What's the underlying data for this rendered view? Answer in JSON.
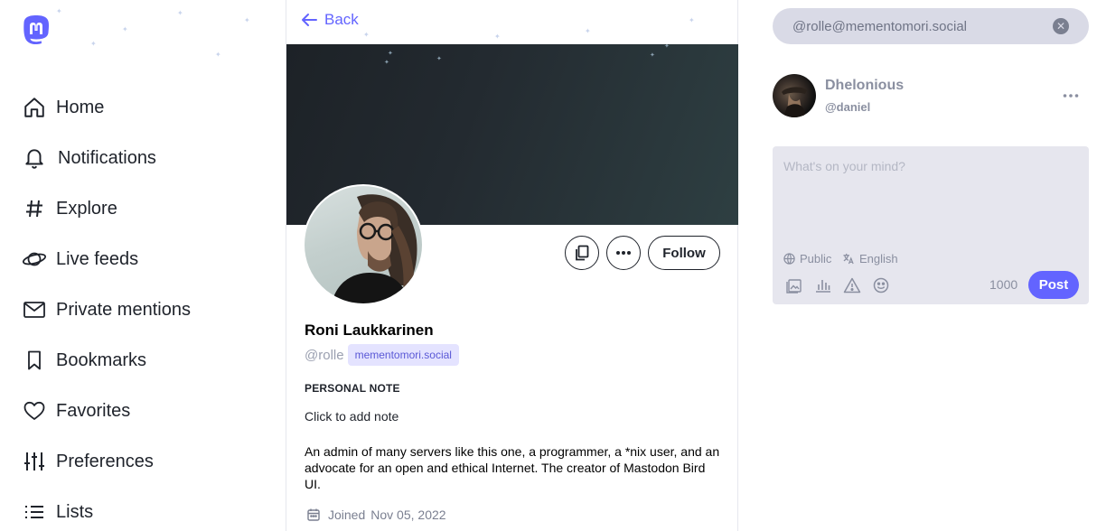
{
  "colors": {
    "accent": "#6364ff",
    "chip_bg": "#e4e3ff",
    "search_bg": "#d9dae6",
    "compose_bg": "#e6e6ee"
  },
  "sidebar": {
    "logo_icon": "mastodon-logo",
    "items": [
      {
        "label": "Home",
        "icon": "home-icon"
      },
      {
        "label": "Notifications",
        "icon": "bell-icon"
      },
      {
        "label": "Explore",
        "icon": "hash-icon"
      },
      {
        "label": "Live feeds",
        "icon": "planet-icon"
      },
      {
        "label": "Private mentions",
        "icon": "mail-icon"
      },
      {
        "label": "Bookmarks",
        "icon": "bookmark-icon"
      },
      {
        "label": "Favorites",
        "icon": "heart-icon"
      },
      {
        "label": "Preferences",
        "icon": "sliders-icon"
      },
      {
        "label": "Lists",
        "icon": "list-icon"
      }
    ]
  },
  "profile": {
    "back_label": "Back",
    "display_name": "Roni Laukkarinen",
    "handle": "@rolle",
    "domain": "mementomori.social",
    "follow_label": "Follow",
    "note_title": "PERSONAL NOTE",
    "note_placeholder": "Click to add note",
    "bio": "An admin of many servers like this one, a programmer, a *nix user, and an advocate for an open and ethical Internet. The creator of Mastodon Bird UI.",
    "joined_label": "Joined",
    "joined_date": "Nov 05, 2022"
  },
  "right": {
    "search_value": "@rolle@mementomori.social",
    "account_name": "Dhelonious",
    "account_handle": "@daniel",
    "compose_placeholder": "What's on your mind?",
    "visibility": "Public",
    "language": "English",
    "char_counter": "1000",
    "post_label": "Post"
  }
}
